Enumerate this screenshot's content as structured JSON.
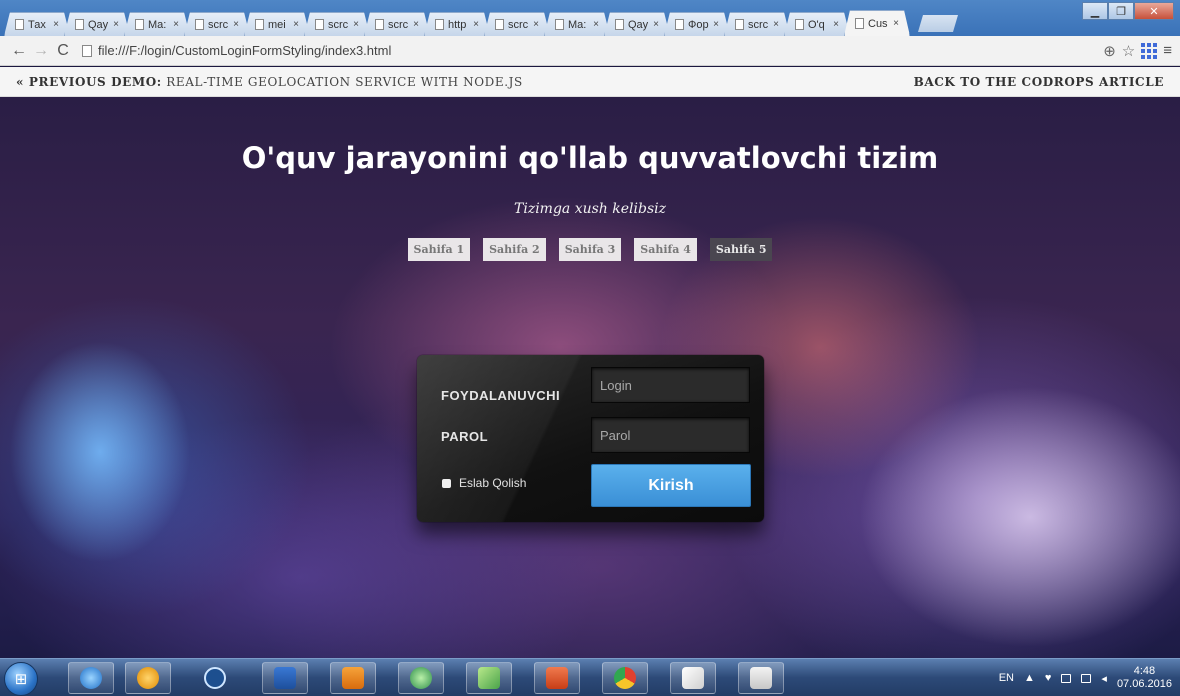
{
  "browser": {
    "tabs": [
      {
        "title": "Тах"
      },
      {
        "title": "Qay"
      },
      {
        "title": "Ma:"
      },
      {
        "title": "scrc"
      },
      {
        "title": "mei"
      },
      {
        "title": "scrc"
      },
      {
        "title": "scrc"
      },
      {
        "title": "http"
      },
      {
        "title": "scrc"
      },
      {
        "title": "Ma:"
      },
      {
        "title": "Qay"
      },
      {
        "title": "Фор"
      },
      {
        "title": "scrc"
      },
      {
        "title": "O'q"
      },
      {
        "title": "Cus"
      }
    ],
    "close_glyph": "×",
    "url": "file:///F:/login/CustomLoginFormStyling/index3.html"
  },
  "codrops": {
    "prev_prefix": "« PREVIOUS DEMO:",
    "prev_title": "REAL-TIME GEOLOCATION SERVICE WITH NODE.JS",
    "back_link": "BACK TO THE CODROPS ARTICLE"
  },
  "page": {
    "title": "O'quv jarayonini qo'llab quvvatlovchi tizim",
    "subtitle": "Tizimga xush kelibsiz",
    "nav": [
      "Sahifa 1",
      "Sahifa 2",
      "Sahifa 3",
      "Sahifa 4",
      "Sahifa 5"
    ]
  },
  "login": {
    "user_label": "FOYDALANUVCHI",
    "user_placeholder": "Login",
    "pass_label": "PAROL",
    "pass_placeholder": "Parol",
    "remember_label": "Eslab Qolish",
    "submit_label": "Kirish"
  },
  "taskbar": {
    "lang": "EN",
    "time": "4:48",
    "date": "07.06.2016"
  },
  "colors": {
    "accent_button": "#4aa3e4",
    "active_page": "#4a4650"
  }
}
